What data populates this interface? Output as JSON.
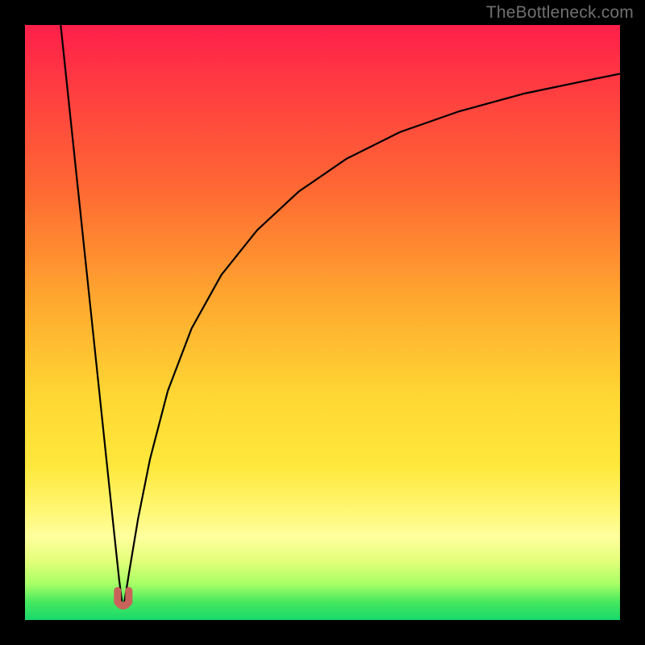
{
  "watermark": {
    "text": "TheBottleneck.com"
  },
  "colors": {
    "page_bg": "#000000",
    "curve": "#000000",
    "marker_fill": "#c9635a",
    "marker_stroke": "#b24f46",
    "gradient_stops": [
      "#ff1f4a",
      "#ff4040",
      "#ff6a33",
      "#ffa72f",
      "#ffd633",
      "#ffe83b",
      "#fff877",
      "#ffff9e",
      "#e4ff7a",
      "#a6ff66",
      "#46e85f",
      "#18d86b"
    ]
  },
  "chart_data": {
    "type": "line",
    "title": "",
    "xlabel": "",
    "ylabel": "",
    "xlim": [
      0,
      100
    ],
    "ylim": [
      0,
      100
    ],
    "grid": false,
    "legend": false,
    "annotations": [
      {
        "name": "minimum-marker",
        "x": 16.5,
        "y": 2.5,
        "shape": "u"
      }
    ],
    "series": [
      {
        "name": "left-branch",
        "x": [
          6.0,
          7.0,
          8.0,
          9.0,
          10.0,
          11.0,
          12.0,
          13.0,
          14.0,
          15.0,
          15.8,
          16.3
        ],
        "y": [
          100,
          90.5,
          81.0,
          71.5,
          62.0,
          52.5,
          43.0,
          33.5,
          24.0,
          14.5,
          7.0,
          3.0
        ]
      },
      {
        "name": "right-branch",
        "x": [
          16.7,
          17.5,
          19.0,
          21.0,
          24.0,
          28.0,
          33.0,
          39.0,
          46.0,
          54.0,
          63.0,
          73.0,
          84.0,
          96.0,
          100.0
        ],
        "y": [
          3.0,
          8.0,
          17.0,
          27.0,
          38.5,
          49.0,
          58.0,
          65.5,
          72.0,
          77.5,
          82.0,
          85.5,
          88.5,
          91.0,
          91.8
        ]
      }
    ]
  }
}
